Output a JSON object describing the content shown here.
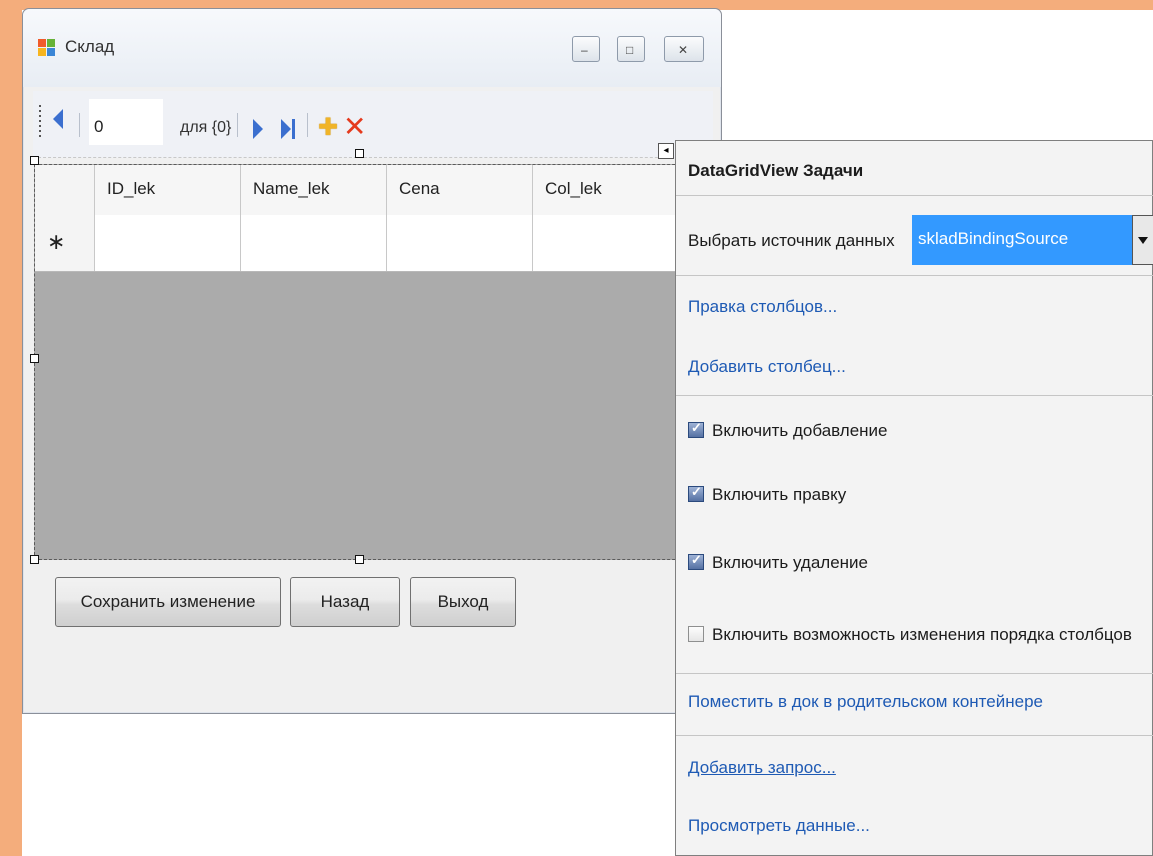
{
  "window": {
    "title": "Склад",
    "minimize_glyph": "–",
    "maximize_glyph": "□",
    "close_glyph": "✕"
  },
  "navigator": {
    "position_value": "0",
    "count_label": "для {0}",
    "icons": [
      "move-previous-icon",
      "move-next-icon",
      "move-last-icon",
      "add-new-icon",
      "delete-icon"
    ],
    "add_glyph": "✚",
    "delete_glyph": "✕"
  },
  "grid": {
    "columns": [
      "ID_lek",
      "Name_lek",
      "Cena",
      "Col_lek"
    ],
    "new_row_marker": "∗",
    "background": "#ababab"
  },
  "buttons": {
    "save": "Сохранить изменение",
    "back": "Назад",
    "exit": "Выход"
  },
  "tasks_panel": {
    "title": "DataGridView Задачи",
    "datasource_label": "Выбрать источник данных",
    "datasource_value": "skladBindingSource",
    "edit_columns": "Правка столбцов...",
    "add_column": "Добавить столбец...",
    "enable_adding": {
      "label": "Включить добавление",
      "checked": true
    },
    "enable_editing": {
      "label": "Включить правку",
      "checked": true
    },
    "enable_deleting": {
      "label": "Включить удаление",
      "checked": true
    },
    "enable_reorder": {
      "label": "Включить возможность изменения порядка столбцов",
      "checked": false
    },
    "dock": "Поместить в док в родительском контейнере",
    "add_query": "Добавить запрос...",
    "preview_data": "Просмотреть данные...",
    "selection_color": "#3399ff",
    "link_color": "#1e5ab4"
  }
}
